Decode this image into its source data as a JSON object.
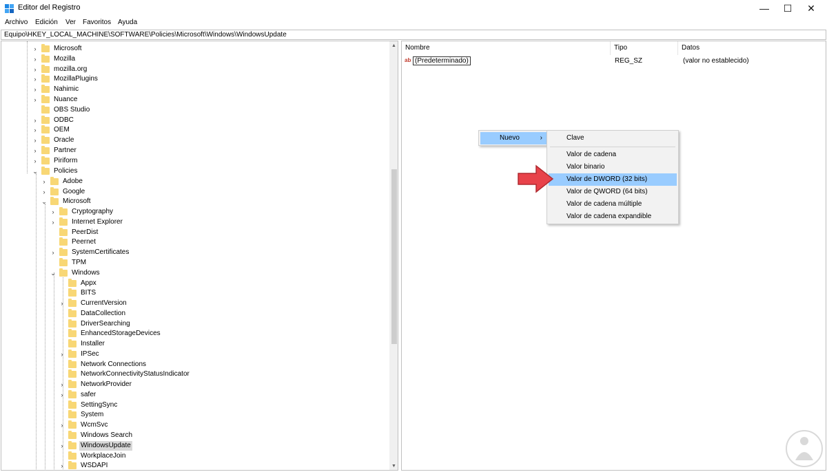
{
  "window": {
    "title": "Editor del Registro",
    "controls": {
      "minimize": "—",
      "maximize": "☐",
      "close": "✕"
    }
  },
  "menu": [
    "Archivo",
    "Edición",
    "Ver",
    "Favoritos",
    "Ayuda"
  ],
  "address": "Equipo\\HKEY_LOCAL_MACHINE\\SOFTWARE\\Policies\\Microsoft\\Windows\\WindowsUpdate",
  "tree": [
    {
      "label": "Microsoft",
      "expander": "›"
    },
    {
      "label": "Mozilla",
      "expander": "›"
    },
    {
      "label": "mozilla.org",
      "expander": "›"
    },
    {
      "label": "MozillaPlugins",
      "expander": "›"
    },
    {
      "label": "Nahimic",
      "expander": "›"
    },
    {
      "label": "Nuance",
      "expander": "›"
    },
    {
      "label": "OBS Studio",
      "expander": ""
    },
    {
      "label": "ODBC",
      "expander": "›"
    },
    {
      "label": "OEM",
      "expander": "›"
    },
    {
      "label": "Oracle",
      "expander": "›"
    },
    {
      "label": "Partner",
      "expander": "›"
    },
    {
      "label": "Piriform",
      "expander": "›"
    },
    {
      "label": "Policies",
      "expander": "⌄"
    },
    {
      "label": "Adobe",
      "expander": "›"
    },
    {
      "label": "Google",
      "expander": "›"
    },
    {
      "label": "Microsoft",
      "expander": "⌄"
    },
    {
      "label": "Cryptography",
      "expander": "›"
    },
    {
      "label": "Internet Explorer",
      "expander": "›"
    },
    {
      "label": "PeerDist",
      "expander": ""
    },
    {
      "label": "Peernet",
      "expander": ""
    },
    {
      "label": "SystemCertificates",
      "expander": "›"
    },
    {
      "label": "TPM",
      "expander": ""
    },
    {
      "label": "Windows",
      "expander": "⌄"
    },
    {
      "label": "Appx",
      "expander": ""
    },
    {
      "label": "BITS",
      "expander": ""
    },
    {
      "label": "CurrentVersion",
      "expander": "›"
    },
    {
      "label": "DataCollection",
      "expander": ""
    },
    {
      "label": "DriverSearching",
      "expander": ""
    },
    {
      "label": "EnhancedStorageDevices",
      "expander": ""
    },
    {
      "label": "Installer",
      "expander": ""
    },
    {
      "label": "IPSec",
      "expander": "›"
    },
    {
      "label": "Network Connections",
      "expander": ""
    },
    {
      "label": "NetworkConnectivityStatusIndicator",
      "expander": ""
    },
    {
      "label": "NetworkProvider",
      "expander": "›"
    },
    {
      "label": "safer",
      "expander": "›"
    },
    {
      "label": "SettingSync",
      "expander": ""
    },
    {
      "label": "System",
      "expander": ""
    },
    {
      "label": "WcmSvc",
      "expander": "›"
    },
    {
      "label": "Windows Search",
      "expander": ""
    },
    {
      "label": "WindowsUpdate",
      "expander": "›",
      "selected": true
    },
    {
      "label": "WorkplaceJoin",
      "expander": ""
    },
    {
      "label": "WSDAPI",
      "expander": "›"
    }
  ],
  "list": {
    "columns": [
      "Nombre",
      "Tipo",
      "Datos"
    ],
    "rows": [
      {
        "icon": "ab",
        "name": "(Predeterminado)",
        "type": "REG_SZ",
        "data": "(valor no establecido)"
      }
    ]
  },
  "context_menu": {
    "parent": {
      "label": "Nuevo",
      "arrow": "›"
    },
    "items_top": [
      "Clave"
    ],
    "items": [
      {
        "label": "Valor de cadena"
      },
      {
        "label": "Valor binario"
      },
      {
        "label": "Valor de DWORD (32 bits)",
        "highlighted": true
      },
      {
        "label": "Valor de QWORD (64 bits)"
      },
      {
        "label": "Valor de cadena múltiple"
      },
      {
        "label": "Valor de cadena expandible"
      }
    ]
  },
  "colors": {
    "highlight": "#99ccff",
    "arrow": "#e8424a",
    "folder": "#f8d775",
    "selected_bg": "#d9d9d9"
  }
}
